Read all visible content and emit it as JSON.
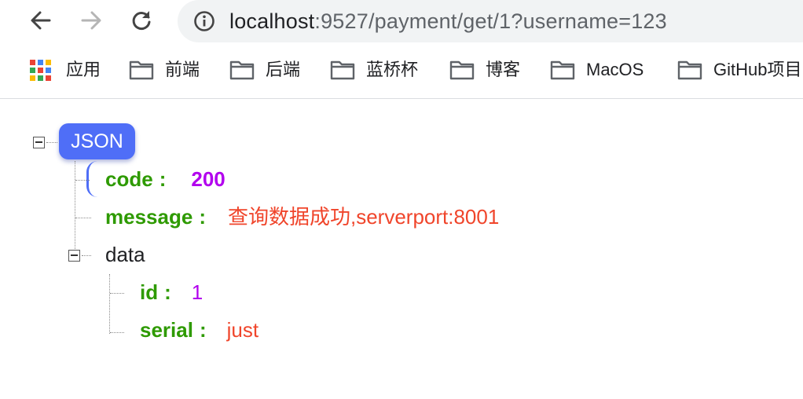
{
  "toolbar": {
    "back_icon": "back-arrow-icon",
    "forward_icon": "forward-arrow-icon",
    "reload_icon": "reload-icon",
    "info_icon": "info-icon",
    "url_host": "localhost",
    "url_rest": ":9527/payment/get/1?username=123"
  },
  "bookmarks": {
    "apps_label": "应用",
    "items": [
      "前端",
      "后端",
      "蓝桥杯",
      "博客",
      "MacOS",
      "GitHub项目"
    ]
  },
  "json_viewer": {
    "root_label": "JSON",
    "code_key": "code",
    "code_value": "200",
    "message_key": "message",
    "message_value": "查询数据成功,serverport:8001",
    "data_key": "data",
    "id_key": "id",
    "id_value": "1",
    "serial_key": "serial",
    "serial_value": "just",
    "colon": ":"
  },
  "colors": {
    "badge": "#4f6ef7",
    "key": "#2e9a00",
    "number": "#b200ee",
    "string": "#f0452b"
  }
}
